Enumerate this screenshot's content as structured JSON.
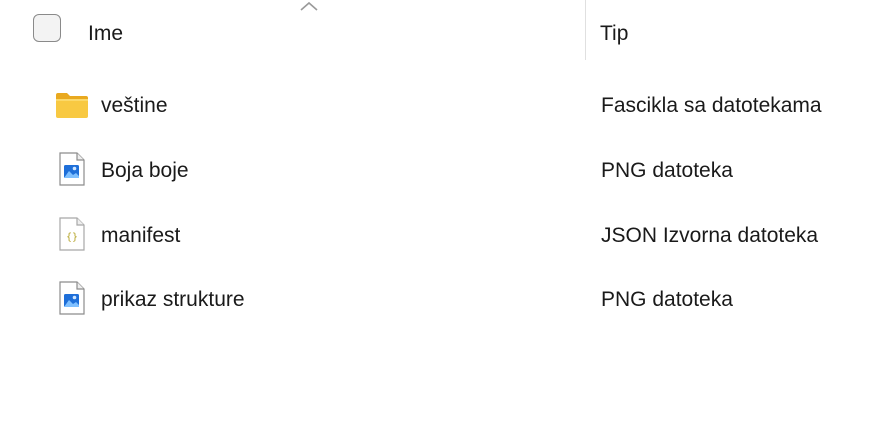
{
  "header": {
    "name_label": "Ime",
    "type_label": "Tip",
    "sort_icon": "chevron-up-icon"
  },
  "files": [
    {
      "name": "veštine",
      "type": "Fascikla sa datotekama",
      "icon": "folder-icon"
    },
    {
      "name": "Boja boje",
      "type": "PNG datoteka",
      "icon": "image-file-icon"
    },
    {
      "name": "manifest",
      "type": "JSON Izvorna datoteka",
      "icon": "json-file-icon"
    },
    {
      "name": "prikaz strukture",
      "type": "PNG datoteka",
      "icon": "image-file-icon"
    }
  ],
  "colors": {
    "folder": "#f8c942",
    "image_accent": "#1e6fd9",
    "json_accent": "#b5a52a"
  }
}
